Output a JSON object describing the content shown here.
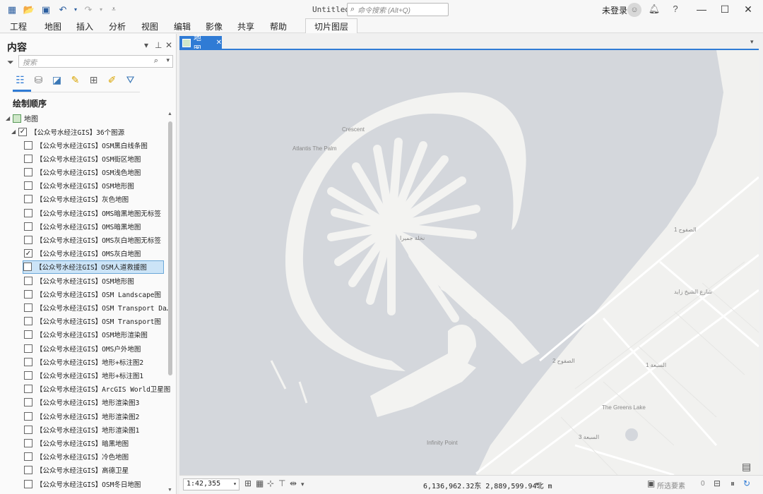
{
  "titlebar": {
    "doc_title": "Untitled",
    "command_search_placeholder": "命令搜索 (Alt+Q)",
    "account_label": "未登录",
    "quick_access_icons": [
      "project-icon",
      "open-icon",
      "save-icon",
      "undo-icon",
      "redo-icon",
      "customize-icon"
    ]
  },
  "ribbon": {
    "tabs": [
      "工程",
      "地图",
      "插入",
      "分析",
      "视图",
      "编辑",
      "影像",
      "共享",
      "帮助"
    ],
    "contextual_tab": "切片图层"
  },
  "contents": {
    "title": "内容",
    "search_placeholder": "搜索",
    "section_label": "绘制顺序",
    "map_node": "地图",
    "group_node": "【公众号水经注GIS】36个图源",
    "layers": [
      {
        "label": "【公众号水经注GIS】OSM黑白线条图",
        "checked": false
      },
      {
        "label": "【公众号水经注GIS】OSM街区地图",
        "checked": false
      },
      {
        "label": "【公众号水经注GIS】OSM浅色地图",
        "checked": false
      },
      {
        "label": "【公众号水经注GIS】OSM地形图",
        "checked": false
      },
      {
        "label": "【公众号水经注GIS】灰色地图",
        "checked": false
      },
      {
        "label": "【公众号水经注GIS】OMS暗黑地图无标签",
        "checked": false
      },
      {
        "label": "【公众号水经注GIS】OMS暗黑地图",
        "checked": false
      },
      {
        "label": "【公众号水经注GIS】OMS灰白地图无标签",
        "checked": false
      },
      {
        "label": "【公众号水经注GIS】OMS灰白地图",
        "checked": true
      },
      {
        "label": "【公众号水经注GIS】OSM人道救援图",
        "checked": false,
        "selected": true
      },
      {
        "label": "【公众号水经注GIS】OSM地形图",
        "checked": false
      },
      {
        "label": "【公众号水经注GIS】OSM Landscape图",
        "checked": false
      },
      {
        "label": "【公众号水经注GIS】OSM Transport Da…",
        "checked": false
      },
      {
        "label": "【公众号水经注GIS】OSM Transport图",
        "checked": false
      },
      {
        "label": "【公众号水经注GIS】OSM地形渲染图",
        "checked": false
      },
      {
        "label": "【公众号水经注GIS】OMS户外地图",
        "checked": false
      },
      {
        "label": "【公众号水经注GIS】地形+标注图2",
        "checked": false
      },
      {
        "label": "【公众号水经注GIS】地形+标注图1",
        "checked": false
      },
      {
        "label": "【公众号水经注GIS】ArcGIS World卫星图",
        "checked": false
      },
      {
        "label": "【公众号水经注GIS】地形渲染图3",
        "checked": false
      },
      {
        "label": "【公众号水经注GIS】地形渲染图2",
        "checked": false
      },
      {
        "label": "【公众号水经注GIS】地形渲染图1",
        "checked": false
      },
      {
        "label": "【公众号水经注GIS】暗黑地图",
        "checked": false
      },
      {
        "label": "【公众号水经注GIS】冷色地图",
        "checked": false
      },
      {
        "label": "【公众号水经注GIS】高德卫星",
        "checked": false
      },
      {
        "label": "【公众号水经注GIS】OSM冬日地图",
        "checked": false
      }
    ]
  },
  "map": {
    "tab_label": "地图",
    "labels": {
      "l1": "Crescent",
      "l2": "Atlantis The Palm",
      "l3": "نخلة جميرا",
      "l4": "الصفوح 1",
      "l5": "الصفوح 2",
      "l6": "السبعة 1",
      "l7": "السبعة 3",
      "l8": "The Greens Lake",
      "l9": "Infinity Point",
      "l10": "شارع الشيخ زايد"
    }
  },
  "statusbar": {
    "scale": "1:42,355",
    "coordinates": "6,136,962.32东  2,889,599.94北 m",
    "selected_features_label": "所选要素",
    "selected_count": "0"
  }
}
